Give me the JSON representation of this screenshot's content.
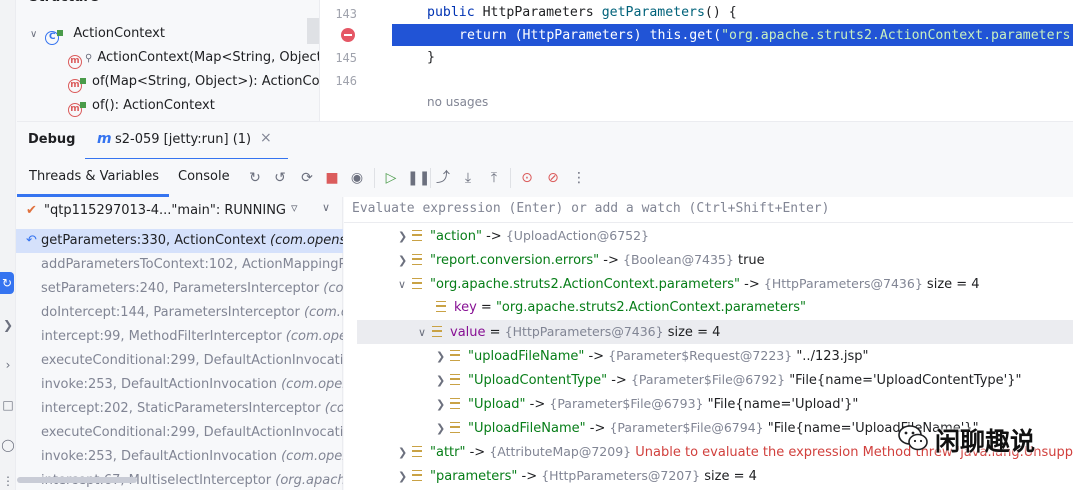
{
  "structure": {
    "title": "Structure",
    "items": [
      {
        "label": "ActionContext",
        "kind": "class"
      },
      {
        "label": "ActionContext(Map<String, Object",
        "kind": "method"
      },
      {
        "label": "of(Map<String, Object>): ActionCo",
        "kind": "method"
      },
      {
        "label": "of(): ActionContext",
        "kind": "method"
      }
    ]
  },
  "editor": {
    "lines": [
      {
        "num": "143",
        "text": "public HttpParameters getParameters() {"
      },
      {
        "num": "",
        "text": "return (HttpParameters) this.get(\"org.apache.struts2.ActionContext.parameters"
      },
      {
        "num": "145",
        "text": "}"
      },
      {
        "num": "146",
        "text": ""
      }
    ],
    "code_parts": {
      "kw_public": "public",
      "type_http": "HttpParameters",
      "method_name": "getParameters",
      "paren_open": "() {",
      "kw_return": "return",
      "cast": "(HttpParameters)",
      "kw_this": "this",
      "get_call": ".get(",
      "string_literal": "\"org.apache.struts2.ActionContext.parameters",
      "close_brace": "}"
    },
    "hint": "no usages"
  },
  "debug": {
    "title": "Debug",
    "session_tab": "s2-059 [jetty:run] (1)",
    "tab_threads": "Threads & Variables",
    "tab_console": "Console",
    "thread_selector": "\"qtp115297013-4...\"main\": RUNNING",
    "eval_placeholder": "Evaluate expression (Enter) or add a watch (Ctrl+Shift+Enter)"
  },
  "frames": [
    {
      "method": "getParameters:330, ActionContext ",
      "pkg": "(com.opensy"
    },
    {
      "method": "addParametersToContext:102, ActionMappingPa",
      "pkg": ""
    },
    {
      "method": "setParameters:240, ParametersInterceptor ",
      "pkg": "(com"
    },
    {
      "method": "doIntercept:144, ParametersInterceptor ",
      "pkg": "(com.op"
    },
    {
      "method": "intercept:99, MethodFilterInterceptor ",
      "pkg": "(com.oper"
    },
    {
      "method": "executeConditional:299, DefaultActionInvocati",
      "pkg": ""
    },
    {
      "method": "invoke:253, DefaultActionInvocation ",
      "pkg": "(com.opens"
    },
    {
      "method": "intercept:202, StaticParametersInterceptor ",
      "pkg": "(com"
    },
    {
      "method": "executeConditional:299, DefaultActionInvocati",
      "pkg": ""
    },
    {
      "method": "invoke:253, DefaultActionInvocation ",
      "pkg": "(com.opens"
    },
    {
      "method": "intercept:67, MultiselectInterceptor ",
      "pkg": "(org.apache"
    }
  ],
  "variables": [
    {
      "name": "\"action\"",
      "arrow": " -> ",
      "type": "{UploadAction@6752}",
      "value": "",
      "level": 0,
      "expanded": false,
      "kind": "str"
    },
    {
      "name": "\"report.conversion.errors\"",
      "arrow": " -> ",
      "type": "{Boolean@7435}",
      "value": " true",
      "level": 0,
      "expanded": false,
      "kind": "str"
    },
    {
      "name": "\"org.apache.struts2.ActionContext.parameters\"",
      "arrow": " -> ",
      "type": "{HttpParameters@7436}",
      "value": "  size = 4",
      "level": 0,
      "expanded": true,
      "kind": "str"
    },
    {
      "name": "key",
      "arrow": " = ",
      "type": "",
      "value": "\"org.apache.struts2.ActionContext.parameters\"",
      "level": 1,
      "expanded": false,
      "kind": "key"
    },
    {
      "name": "value",
      "arrow": " = ",
      "type": "{HttpParameters@7436}",
      "value": "  size = 4",
      "level": 1,
      "expanded": true,
      "kind": "key"
    },
    {
      "name": "\"uploadFileName\"",
      "arrow": " -> ",
      "type": "{Parameter$Request@7223}",
      "value": " \"../123.jsp\"",
      "level": 2,
      "expanded": false,
      "kind": "str"
    },
    {
      "name": "\"UploadContentType\"",
      "arrow": " -> ",
      "type": "{Parameter$File@6792}",
      "value": " \"File{name='UploadContentType'}\"",
      "level": 2,
      "expanded": false,
      "kind": "str"
    },
    {
      "name": "\"Upload\"",
      "arrow": " -> ",
      "type": "{Parameter$File@6793}",
      "value": " \"File{name='Upload'}\"",
      "level": 2,
      "expanded": false,
      "kind": "str"
    },
    {
      "name": "\"UploadFileName\"",
      "arrow": " -> ",
      "type": "{Parameter$File@6794}",
      "value": " \"File{name='UploadFileName'}\"",
      "level": 2,
      "expanded": false,
      "kind": "str"
    },
    {
      "name": "\"attr\"",
      "arrow": " -> ",
      "type": "{AttributeMap@7209}",
      "value": " Unable to evaluate the expression Method threw 'java.lang.UnsupportedOperationException'",
      "level": 0,
      "expanded": false,
      "kind": "err"
    },
    {
      "name": "\"parameters\"",
      "arrow": " -> ",
      "type": "{HttpParameters@7207}",
      "value": "  size = 4",
      "level": 0,
      "expanded": false,
      "kind": "str"
    }
  ],
  "watermark": "闲聊趣说",
  "colors": {
    "accent": "#3574f0",
    "exec_line": "#2154d6",
    "breakpoint": "#e55765",
    "string": "#067d17",
    "keyword": "#0033b3",
    "error": "#d1403d"
  }
}
